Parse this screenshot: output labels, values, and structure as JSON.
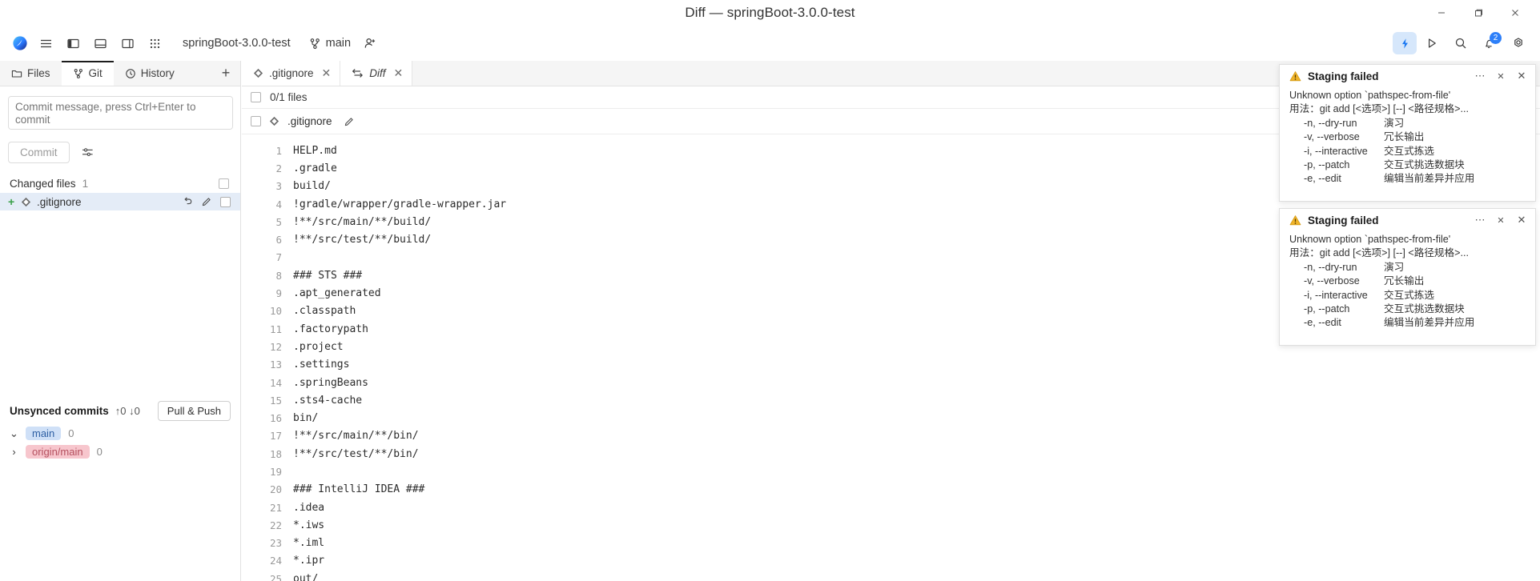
{
  "window": {
    "title": "Diff — springBoot-3.0.0-test",
    "controls": [
      {
        "name": "minimize-button",
        "glyph": "—"
      },
      {
        "name": "maximize-button",
        "glyph": "❐"
      },
      {
        "name": "close-button",
        "glyph": "✕"
      }
    ]
  },
  "toolbar": {
    "app_logo": "app-logo",
    "main_menu_icon": "hamburger-menu-icon",
    "left_panel_icon": "toggle-left-panel-icon",
    "bottom_panel_icon": "toggle-bottom-panel-icon",
    "right_panel_icon": "toggle-right-panel-icon",
    "grid_icon": "app-grid-icon",
    "project_name": "springBoot-3.0.0-test",
    "branch_icon": "git-branch-icon",
    "branch_name": "main",
    "share_icon": "add-collaborator-icon",
    "ai_icon": "ai-assistant-icon",
    "run_icon": "run-icon",
    "search_icon": "search-icon",
    "notifications_icon": "notification-bell-icon",
    "notifications_count": "2",
    "settings_icon": "settings-gear-icon"
  },
  "sidebar": {
    "tabs": [
      {
        "label": "Files",
        "icon": "folder-icon",
        "active": false
      },
      {
        "label": "Git",
        "icon": "git-branch-icon",
        "active": true
      },
      {
        "label": "History",
        "icon": "clock-icon",
        "active": false
      }
    ],
    "add_tab_glyph": "+",
    "commit_message_placeholder": "Commit message, press Ctrl+Enter to commit",
    "commit_message_value": "",
    "commit_button": "Commit",
    "commit_settings_icon": "commit-options-icon",
    "changed_files_label": "Changed files",
    "changed_files_count": "1",
    "file": {
      "status": "+",
      "icon": "gitignore-file-icon",
      "name": ".gitignore",
      "revert_icon": "revert-icon",
      "edit_icon": "pencil-icon"
    },
    "unsynced": {
      "title": "Unsynced commits",
      "counts": "↑0 ↓0",
      "pull_push_button": "Pull & Push",
      "branches": [
        {
          "caret": "⌄",
          "name": "main",
          "count": "0",
          "kind": "local"
        },
        {
          "caret": "›",
          "name": "origin/main",
          "count": "0",
          "kind": "remote"
        }
      ]
    }
  },
  "editor": {
    "tabs": [
      {
        "label": ".gitignore",
        "icon": "gitignore-file-icon",
        "active": false,
        "italic": false
      },
      {
        "label": "Diff",
        "icon": "diff-icon",
        "active": true,
        "italic": true
      }
    ],
    "files_selected_label": "0/1 files",
    "diff_file_name": ".gitignore",
    "diff_file_icon": "gitignore-file-icon",
    "diff_edit_icon": "pencil-icon",
    "lines": [
      {
        "num": "1",
        "text": "HELP.md"
      },
      {
        "num": "2",
        "text": ".gradle"
      },
      {
        "num": "3",
        "text": "build/"
      },
      {
        "num": "4",
        "text": "!gradle/wrapper/gradle-wrapper.jar"
      },
      {
        "num": "5",
        "text": "!**/src/main/**/build/"
      },
      {
        "num": "6",
        "text": "!**/src/test/**/build/"
      },
      {
        "num": "7",
        "text": ""
      },
      {
        "num": "8",
        "text": "### STS ###"
      },
      {
        "num": "9",
        "text": ".apt_generated"
      },
      {
        "num": "10",
        "text": ".classpath"
      },
      {
        "num": "11",
        "text": ".factorypath"
      },
      {
        "num": "12",
        "text": ".project"
      },
      {
        "num": "13",
        "text": ".settings"
      },
      {
        "num": "14",
        "text": ".springBeans"
      },
      {
        "num": "15",
        "text": ".sts4-cache"
      },
      {
        "num": "16",
        "text": "bin/"
      },
      {
        "num": "17",
        "text": "!**/src/main/**/bin/"
      },
      {
        "num": "18",
        "text": "!**/src/test/**/bin/"
      },
      {
        "num": "19",
        "text": ""
      },
      {
        "num": "20",
        "text": "### IntelliJ IDEA ###"
      },
      {
        "num": "21",
        "text": ".idea"
      },
      {
        "num": "22",
        "text": "*.iws"
      },
      {
        "num": "23",
        "text": "*.iml"
      },
      {
        "num": "24",
        "text": "*.ipr"
      },
      {
        "num": "25",
        "text": "out/"
      }
    ]
  },
  "notifications": [
    {
      "title": "Staging failed",
      "warn_icon": "warning-triangle-icon",
      "more_glyph": "⋯",
      "collapse_glyph": "✕",
      "close_glyph": "✕",
      "line1": "Unknown option `pathspec-from-file'",
      "line2": "用法：git add [<选项>] [--] <路径规格>...",
      "options": [
        {
          "flag": "-n, --dry-run",
          "desc": "演习"
        },
        {
          "flag": "-v, --verbose",
          "desc": "冗长输出"
        },
        {
          "flag": "-i, --interactive",
          "desc": "交互式拣选"
        },
        {
          "flag": "-p, --patch",
          "desc": "交互式挑选数据块"
        },
        {
          "flag": "-e, --edit",
          "desc": "编辑当前差异并应用"
        }
      ]
    },
    {
      "title": "Staging failed",
      "warn_icon": "warning-triangle-icon",
      "more_glyph": "⋯",
      "collapse_glyph": "✕",
      "close_glyph": "✕",
      "line1": "Unknown option `pathspec-from-file'",
      "line2": "用法：git add [<选项>] [--] <路径规格>...",
      "options": [
        {
          "flag": "-n, --dry-run",
          "desc": "演习"
        },
        {
          "flag": "-v, --verbose",
          "desc": "冗长输出"
        },
        {
          "flag": "-i, --interactive",
          "desc": "交互式拣选"
        },
        {
          "flag": "-p, --patch",
          "desc": "交互式挑选数据块"
        },
        {
          "flag": "-e, --edit",
          "desc": "编辑当前差异并应用"
        }
      ]
    }
  ],
  "colors": {
    "accent_blue": "#2d7ff9",
    "selection_blue": "#e4ecf7",
    "warning_amber": "#e8a31e",
    "added_green": "#3aa14a",
    "local_branch": "#cfe0f7",
    "remote_branch": "#f7c6cd"
  }
}
